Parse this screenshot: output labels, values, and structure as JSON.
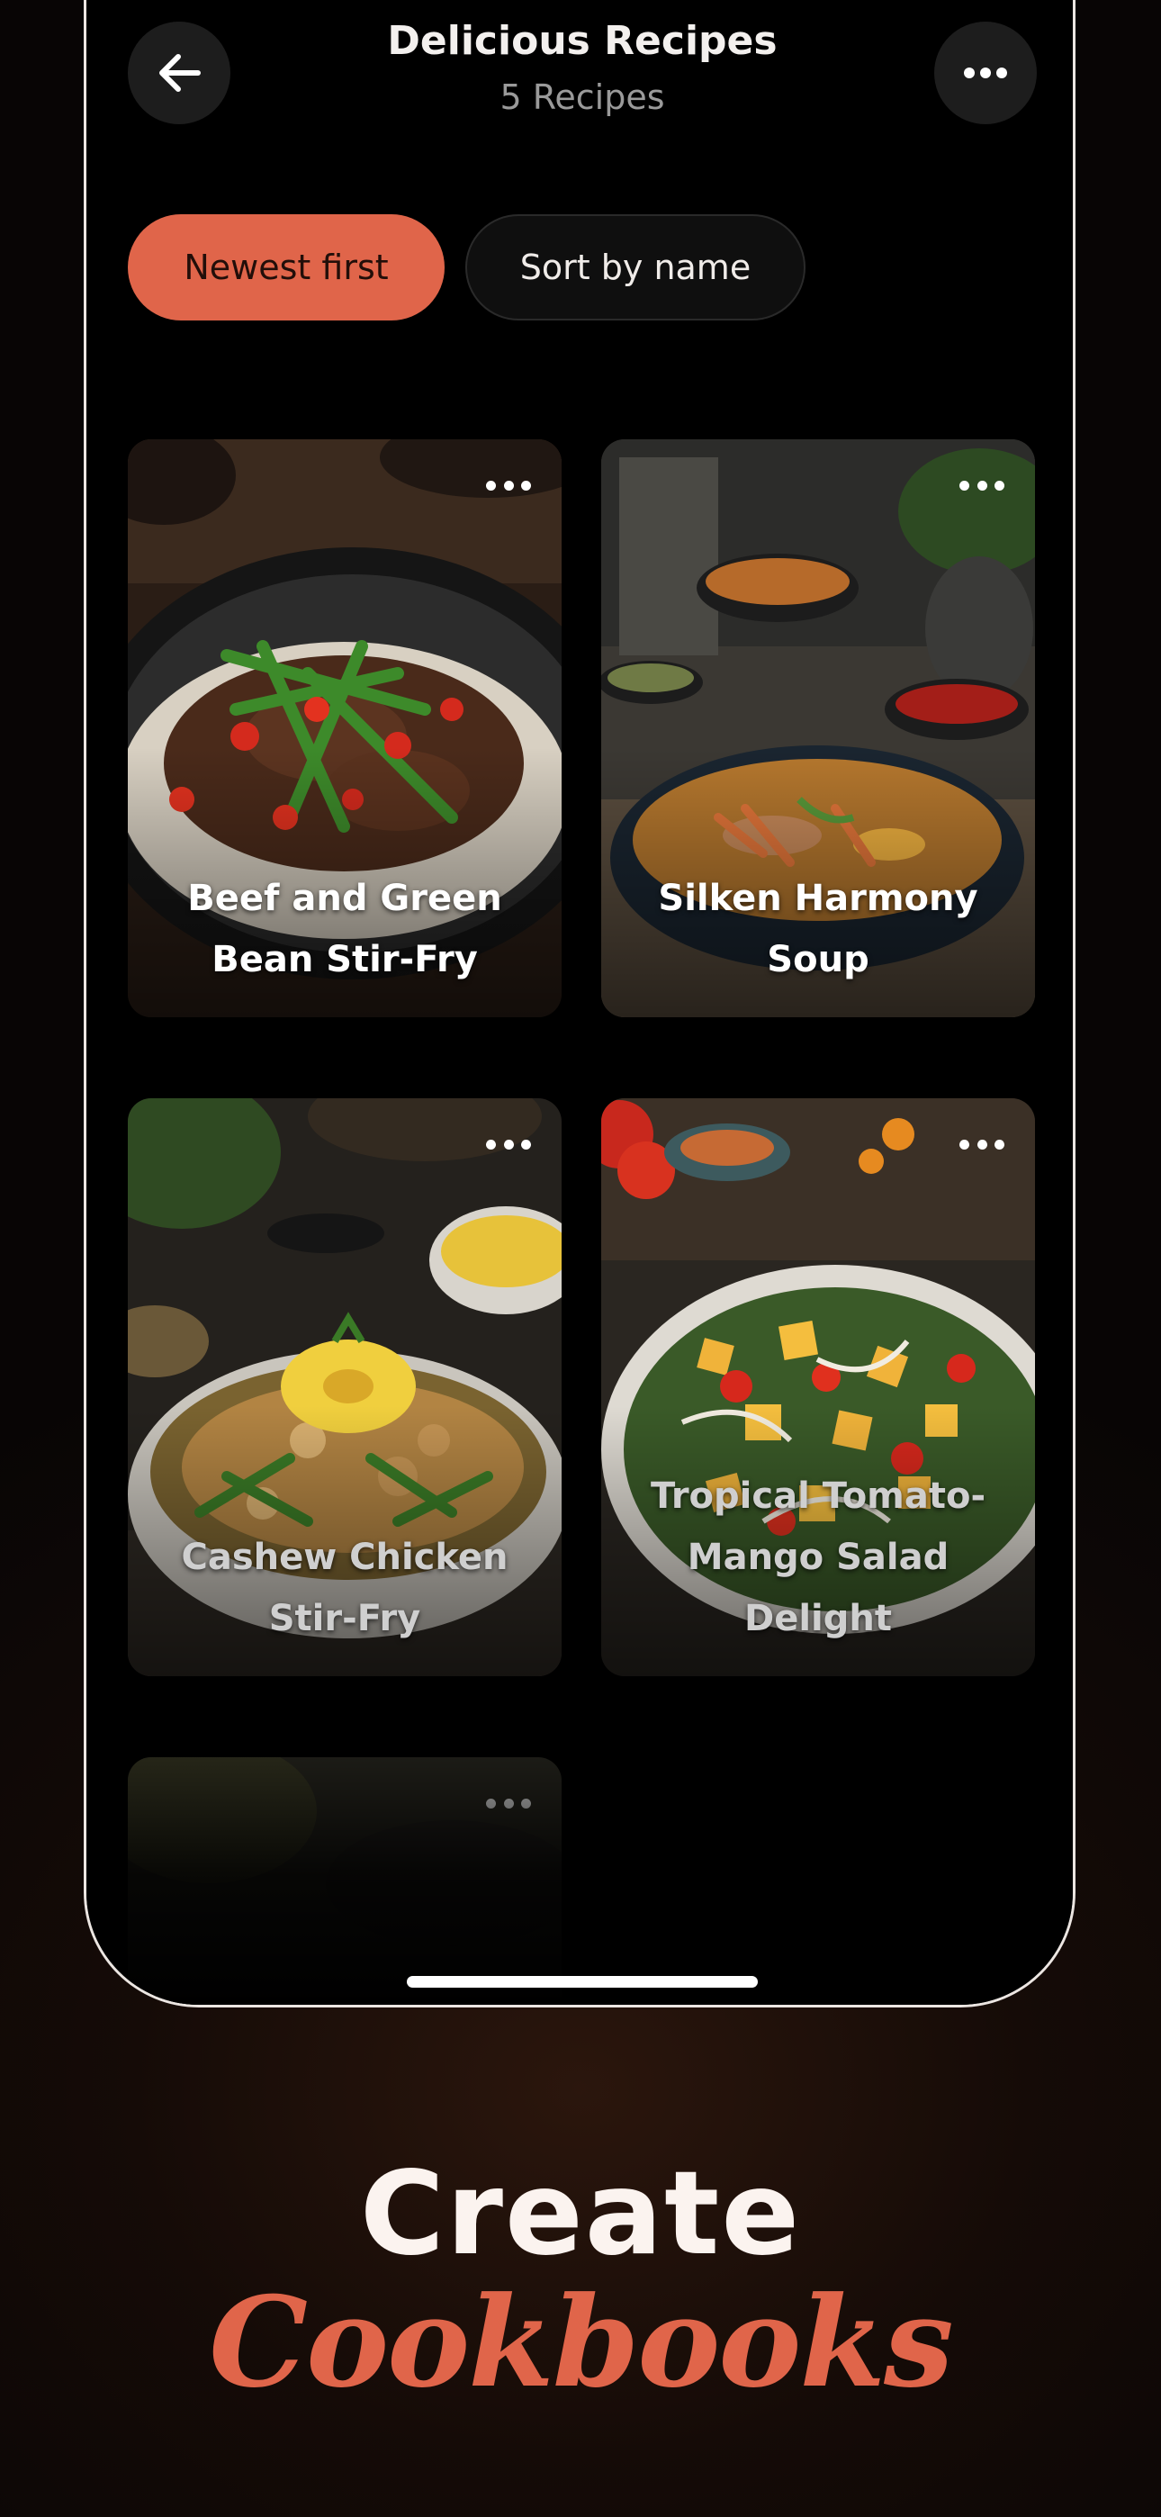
{
  "header": {
    "title": "Delicious Recipes",
    "subtitle": "5 Recipes",
    "back_icon": "arrow-left-icon",
    "more_icon": "more-horizontal-icon"
  },
  "sort": {
    "newest_label": "Newest first",
    "name_label": "Sort by name",
    "active": "newest_label"
  },
  "recipes": [
    {
      "title_line1": "Beef and Green",
      "title_line2": "Bean Stir-Fry"
    },
    {
      "title_line1": "Silken Harmony",
      "title_line2": "Soup"
    },
    {
      "title_line1": "Cashew Chicken",
      "title_line2": "Stir-Fry"
    },
    {
      "title_line1": "Tropical Tomato-",
      "title_line2": "Mango Salad Delight"
    },
    {
      "title_line1": "",
      "title_line2": ""
    }
  ],
  "promo": {
    "line1": "Create",
    "line2": "Cookbooks"
  },
  "colors": {
    "accent": "#e0654a",
    "background": "#000000",
    "surface": "#1d1d1d"
  }
}
